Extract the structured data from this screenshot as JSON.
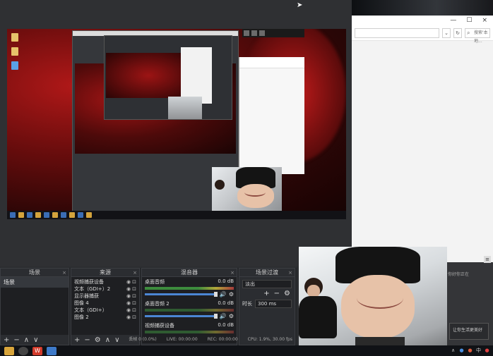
{
  "docks": {
    "scenes": {
      "title": "场景",
      "items": [
        "场景"
      ]
    },
    "sources": {
      "title": "来源",
      "items": [
        "视频捕获设备",
        "文本（GDI+）2",
        "显示器捕获",
        "图像 4",
        "文本（GDI+）",
        "图像 2"
      ]
    },
    "mixer": {
      "title": "混音器",
      "channels": [
        {
          "name": "桌面音频",
          "db": "0.0 dB",
          "muted": false
        },
        {
          "name": "桌面音频 2",
          "db": "0.0 dB",
          "muted": true
        },
        {
          "name": "视频捕获设备",
          "db": "0.0 dB",
          "muted": false
        }
      ]
    },
    "transitions": {
      "title": "场景过渡",
      "selected": "淡出",
      "duration_label": "时长",
      "duration_value": "300 ms"
    }
  },
  "icons": {
    "add": "+",
    "remove": "−",
    "up": "∧",
    "down": "∨",
    "gear": "⚙",
    "speaker": "🔊",
    "close": "×",
    "windows": "⊞"
  },
  "statusbar": {
    "dropped": "丢帧 0 (0.0%)",
    "live": "LIVE: 00:00:00",
    "rec": "REC: 00:00:00",
    "cpu": "CPU: 1.9%, 30.00 fps"
  },
  "right_explorer": {
    "search_placeholder": "搜索'本地...",
    "ad_text": "你好你正在",
    "ad_box": "让你生活更美好"
  },
  "colors": {
    "accent": "#4b86d4",
    "muted": "#e04040",
    "meter_green": "#3d8c3d"
  }
}
